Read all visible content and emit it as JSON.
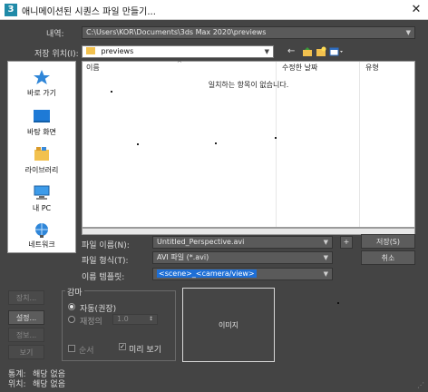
{
  "window": {
    "icon_letter": "3",
    "title": "애니메이션된 시퀀스 파일 만들기...",
    "close": "✕"
  },
  "history": {
    "label": "내역:",
    "value": "C:\\Users\\KOR\\Documents\\3ds Max 2020\\previews"
  },
  "save_in": {
    "label": "저장 위치(I):",
    "value": "previews"
  },
  "places": [
    {
      "label": "바로 가기",
      "icon": "quick-access-star-icon"
    },
    {
      "label": "바탕 화면",
      "icon": "desktop-icon"
    },
    {
      "label": "라이브러리",
      "icon": "library-icon"
    },
    {
      "label": "내 PC",
      "icon": "this-pc-icon"
    },
    {
      "label": "네트워크",
      "icon": "network-icon"
    }
  ],
  "file_list": {
    "columns": [
      "이름",
      "수정한 날짜",
      "유형"
    ],
    "empty_message": "일치하는 항목이 없습니다."
  },
  "file_name": {
    "label": "파일 이름(N):",
    "value": "Untitled_Perspective.avi",
    "plus": "+"
  },
  "file_type": {
    "label": "파일 형식(T):",
    "value": "AVI 파일 (*.avi)"
  },
  "name_template": {
    "label": "이름 템플릿:",
    "value": "<scene>_<camera/view>"
  },
  "buttons": {
    "save": "저장(S)",
    "cancel": "취소",
    "setup": "설정...",
    "info": "정보...",
    "view": "보기",
    "devices": "장치..."
  },
  "gamma": {
    "legend": "감마",
    "auto_label": "자동(권장)",
    "override_label": "재정의",
    "override_value": "1.0"
  },
  "options": {
    "sequence_label": "순서",
    "preview_label": "미리 보기",
    "preview_checked": true,
    "sequence_checked": false
  },
  "preview_image_label": "이미지",
  "stats": {
    "stats_label": "통계:",
    "stats_value": "해당 없음",
    "location_label": "위치:",
    "location_value": "해당 없음"
  },
  "colors": {
    "dialog_bg": "#444444",
    "selection": "#1e6fd6",
    "folder": "#f2c14e"
  }
}
